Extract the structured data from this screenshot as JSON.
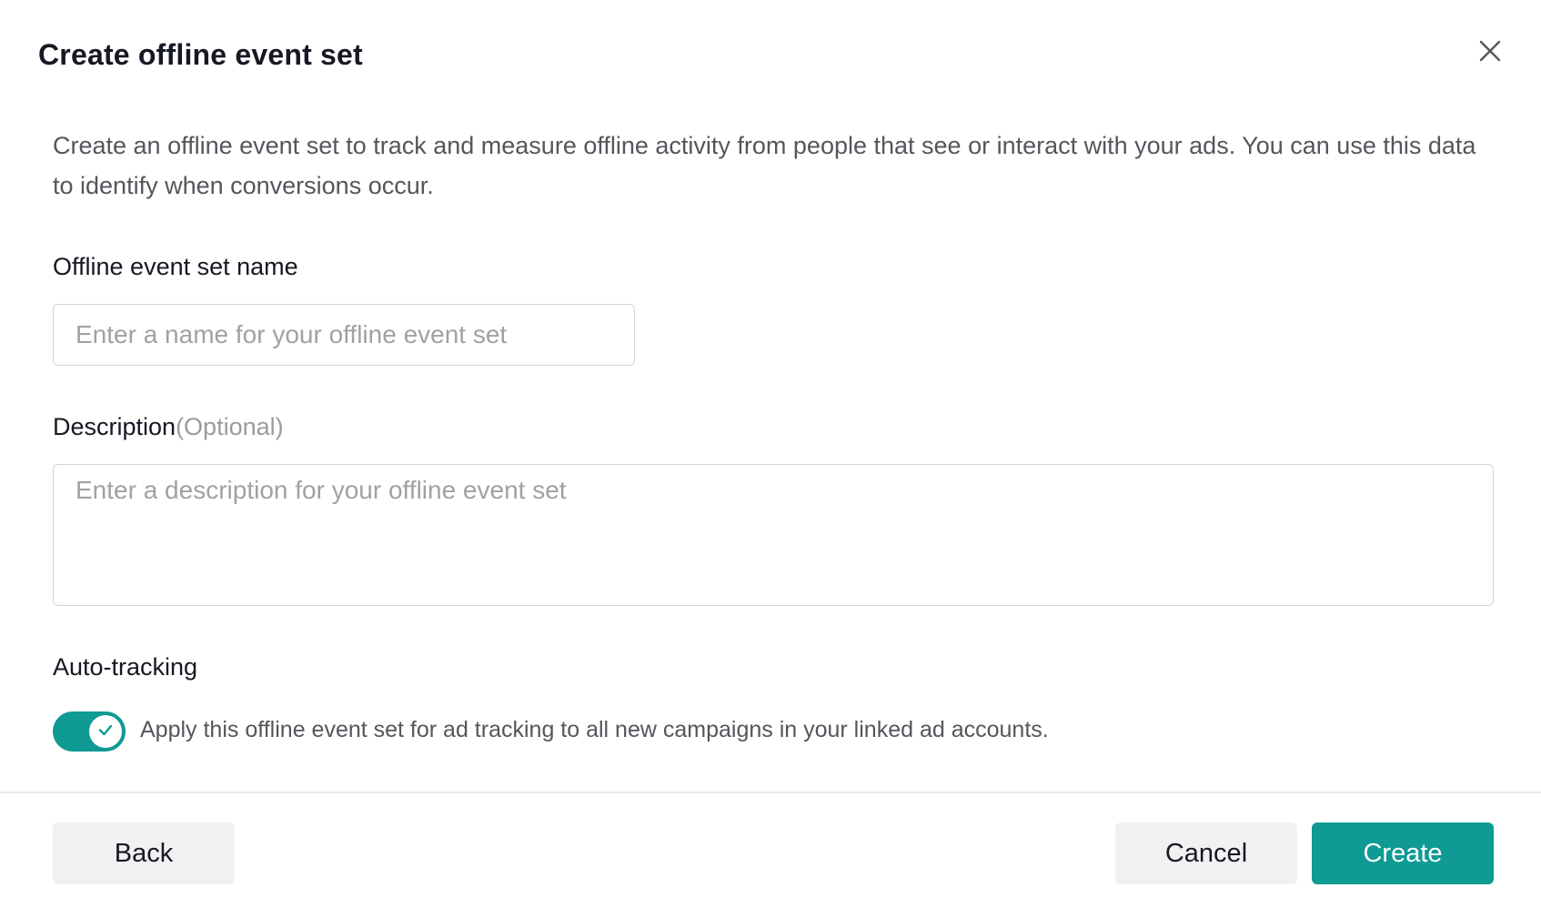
{
  "dialog": {
    "title": "Create offline event set",
    "intro_text": "Create an offline event set to track and measure offline activity from people that see or interact with your ads. You can use this data to identify when conversions occur.",
    "close_icon": "close-icon"
  },
  "form": {
    "name": {
      "label": "Offline event set name",
      "placeholder": "Enter a name for your offline event set",
      "value": ""
    },
    "description": {
      "label": "Description",
      "optional_label": "(Optional)",
      "placeholder": "Enter a description for your offline event set",
      "value": ""
    },
    "auto_tracking": {
      "label": "Auto-tracking",
      "toggle_on": true,
      "toggle_icon": "check-icon",
      "text": "Apply this offline event set for ad tracking to all new campaigns in your linked ad accounts."
    }
  },
  "footer": {
    "back_label": "Back",
    "cancel_label": "Cancel",
    "create_label": "Create"
  },
  "colors": {
    "accent": "#0f9a94",
    "secondary_button": "#f1f1f2",
    "text_primary": "#161823",
    "text_secondary": "#55565c",
    "placeholder": "#a0a1a6"
  }
}
